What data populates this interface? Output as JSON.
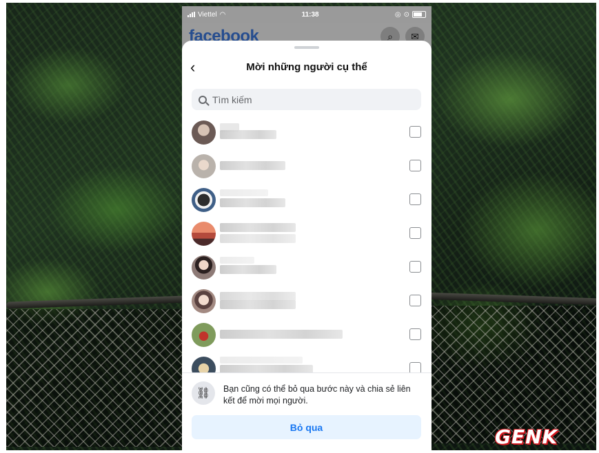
{
  "status_bar": {
    "carrier": "Viettel",
    "time": "11:38"
  },
  "app": {
    "brand": "facebook",
    "brand_color": "#264d8f"
  },
  "dialog": {
    "title": "Mời những người cụ thể",
    "search_placeholder": "Tìm kiếm",
    "friends": [
      {
        "avatar_color": "#6b5a55",
        "checked": false
      },
      {
        "avatar_color": "#b9b2ab",
        "checked": false
      },
      {
        "avatar_color": "#3f5f87",
        "checked": false
      },
      {
        "avatar_color": "#b44a3c",
        "checked": false
      },
      {
        "avatar_color": "#8d7a76",
        "checked": false
      },
      {
        "avatar_color": "#a38a82",
        "checked": false
      },
      {
        "avatar_color": "#7f9b5c",
        "checked": false
      },
      {
        "avatar_color": "#3c4d5e",
        "checked": false
      }
    ],
    "footer_text": "Bạn cũng có thể bỏ qua bước này và chia sẻ liên kết để mời mọi người.",
    "skip_label": "Bỏ qua",
    "skip_color": "#1877f2"
  },
  "watermark": "GENK"
}
